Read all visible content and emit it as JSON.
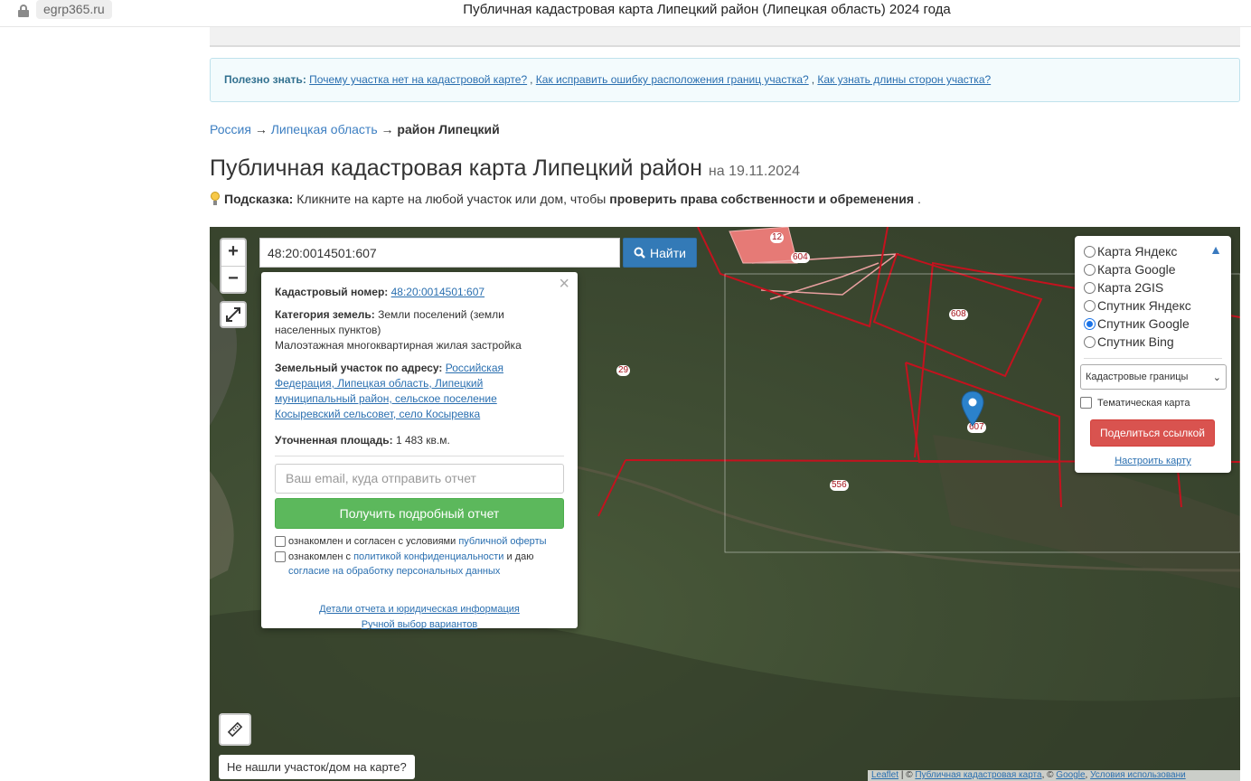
{
  "browser": {
    "domain": "egrp365.ru",
    "tab_title": "Публичная кадастровая карта Липецкий район (Липецкая область) 2024 года"
  },
  "info": {
    "label": "Полезно знать:",
    "links": [
      "Почему участка нет на кадастровой карте?",
      "Как исправить ошибку расположения границ участка?",
      "Как узнать длины сторон участка?"
    ]
  },
  "breadcrumb": {
    "items": [
      "Россия",
      "Липецкая область"
    ],
    "current": "район Липецкий",
    "sep": "→"
  },
  "page": {
    "title": "Публичная кадастровая карта Липецкий район",
    "date": "на 19.11.2024"
  },
  "hint": {
    "label": "Подсказка:",
    "text": "Кликните на карте на любой участок или дом, чтобы",
    "bold": "проверить права собственности и обременения",
    "end": "."
  },
  "map": {
    "search_value": "48:20:0014501:607",
    "search_button": "Найти",
    "zoom_in": "+",
    "zoom_out": "−",
    "parcel_labels": [
      "12",
      "604",
      "608",
      "29",
      "607",
      "556"
    ],
    "not_found": "Не нашли участок/дом на карте?",
    "attribution": {
      "leaflet": "Leaflet",
      "sep": "| ©",
      "pkk": "Публичная кадастровая карта",
      "mid": ", ©",
      "google": "Google",
      "terms": "Условия использовани"
    }
  },
  "popup": {
    "cad_label": "Кадастровый номер:",
    "cad_value": "48:20:0014501:607",
    "cat_label": "Категория земель:",
    "cat_value": "Земли поселений (земли населенных пунктов)",
    "use_value": "Малоэтажная многоквартирная жилая застройка",
    "addr_label": "Земельный участок по адресу:",
    "addr_value": "Российская Федерация, Липецкая область, Липецкий муниципальный район, сельское поселение Косыревский сельсовет, село Косыревка",
    "area_label": "Уточненная площадь:",
    "area_value": "1 483 кв.м.",
    "email_placeholder": "Ваш email, куда отправить отчет",
    "report_button": "Получить подробный отчет",
    "check1_text": "ознакомлен и согласен с условиями",
    "check1_link": "публичной оферты",
    "check2_text": "ознакомлен с",
    "check2_link": "политикой конфиденциальности",
    "check2_mid": "и даю",
    "check2_link2": "согласие на обработку персональных данных",
    "link_details": "Детали отчета и юридическая информация",
    "link_manual": "Ручной выбор вариантов"
  },
  "layers": {
    "options": [
      "Карта Яндекс",
      "Карта Google",
      "Карта 2GIS",
      "Спутник Яндекс",
      "Спутник Google",
      "Спутник Bing"
    ],
    "selected": "Спутник Google",
    "select_value": "Кадастровые границы",
    "thematic": "Тематическая карта",
    "share": "Поделиться ссылкой",
    "setup": "Настроить карту"
  },
  "colors": {
    "parcel_border": "#c4121e",
    "accent": "#337ab7",
    "green": "#5cb85c",
    "red": "#d9534f"
  }
}
